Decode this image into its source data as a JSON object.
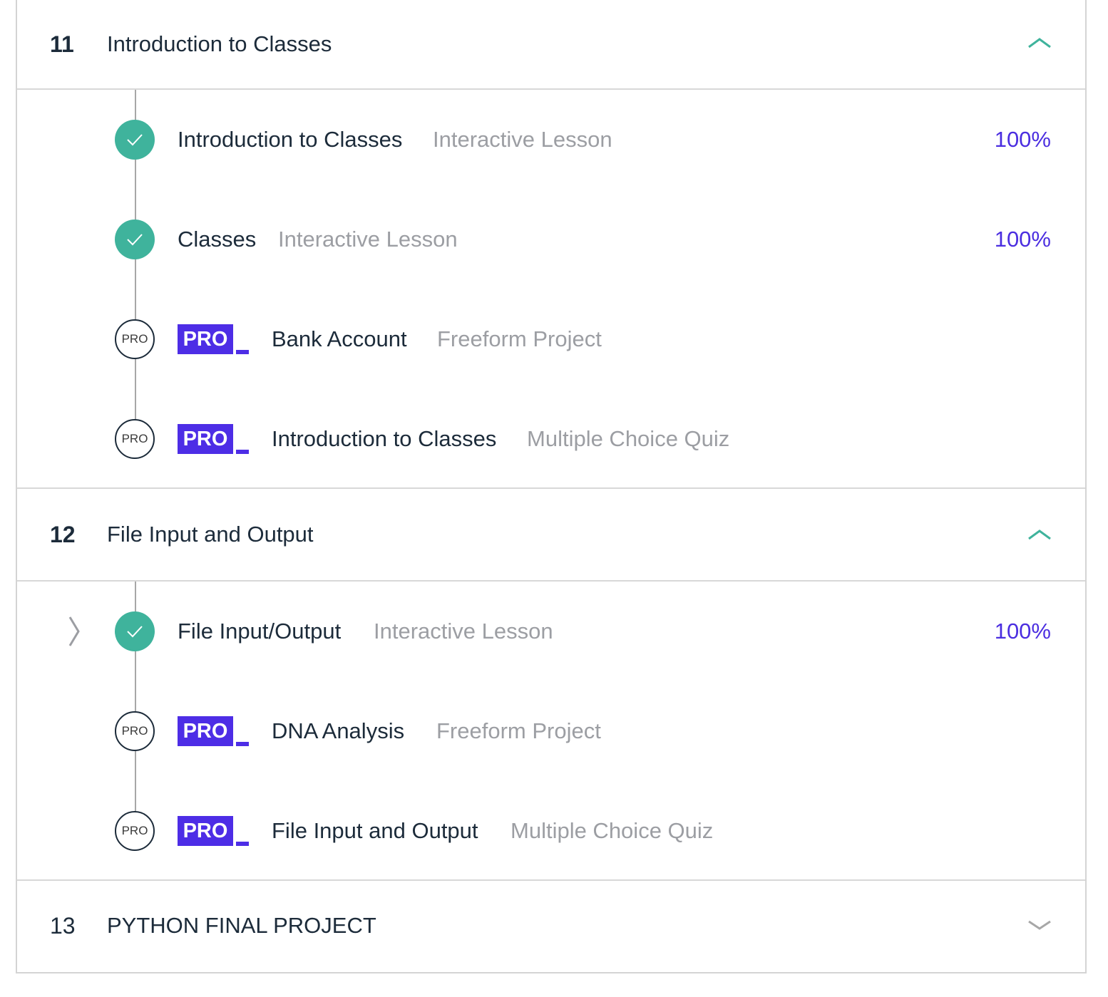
{
  "modules": [
    {
      "number": "11",
      "title": "Introduction to Classes",
      "expanded": true,
      "chevron_icon": "chevron-up-icon",
      "items": [
        {
          "title": "Introduction to Classes",
          "type": "Interactive Lesson",
          "progress": "100%",
          "status": "complete"
        },
        {
          "title": "Classes",
          "type": "Interactive Lesson",
          "progress": "100%",
          "status": "complete"
        },
        {
          "title": "Bank Account",
          "type": "Freeform Project",
          "status": "locked",
          "circle_label": "PRO",
          "badge": "PRO"
        },
        {
          "title": "Introduction to Classes",
          "type": "Multiple Choice Quiz",
          "status": "locked",
          "circle_label": "PRO",
          "badge": "PRO"
        }
      ]
    },
    {
      "number": "12",
      "title": "File Input and Output",
      "expanded": true,
      "chevron_icon": "chevron-up-icon",
      "items": [
        {
          "title": "File Input/Output",
          "type": "Interactive Lesson",
          "progress": "100%",
          "status": "complete",
          "current_icon": "chevron-right-icon"
        },
        {
          "title": "DNA Analysis",
          "type": "Freeform Project",
          "status": "locked",
          "circle_label": "PRO",
          "badge": "PRO"
        },
        {
          "title": "File Input and Output",
          "type": "Multiple Choice Quiz",
          "status": "locked",
          "circle_label": "PRO",
          "badge": "PRO"
        }
      ]
    },
    {
      "number": "13",
      "title": "PYTHON FINAL PROJECT",
      "expanded": false,
      "chevron_icon": "chevron-down-icon",
      "items": []
    }
  ],
  "colors": {
    "complete": "#3fb39c",
    "progress_text": "#4b2ee0",
    "pro_badge": "#4d2de6",
    "chevron_active": "#3fb39c",
    "chevron_inactive": "#a7a7a7"
  }
}
